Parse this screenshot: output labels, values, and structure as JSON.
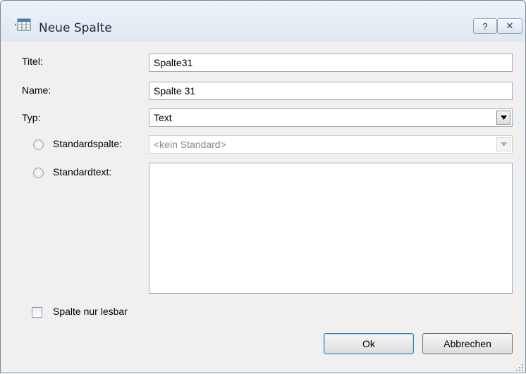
{
  "window": {
    "title": "Neue Spalte",
    "help_label": "?",
    "close_label": "✕"
  },
  "form": {
    "titel_label": "Titel:",
    "titel_value": "Spalte31",
    "name_label": "Name:",
    "name_value": "Spalte 31",
    "typ_label": "Typ:",
    "typ_value": "Text",
    "standardspalte_label": "Standardspalte:",
    "standardspalte_value": "<kein Standard>",
    "standardtext_label": "Standardtext:",
    "standardtext_value": "",
    "readonly_label": "Spalte nur lesbar"
  },
  "buttons": {
    "ok_label": "Ok",
    "cancel_label": "Abbrechen"
  },
  "icons": {
    "title": "column-add-icon",
    "dropdown": "chevron-down-icon",
    "grip": "resize-grip-icon"
  }
}
